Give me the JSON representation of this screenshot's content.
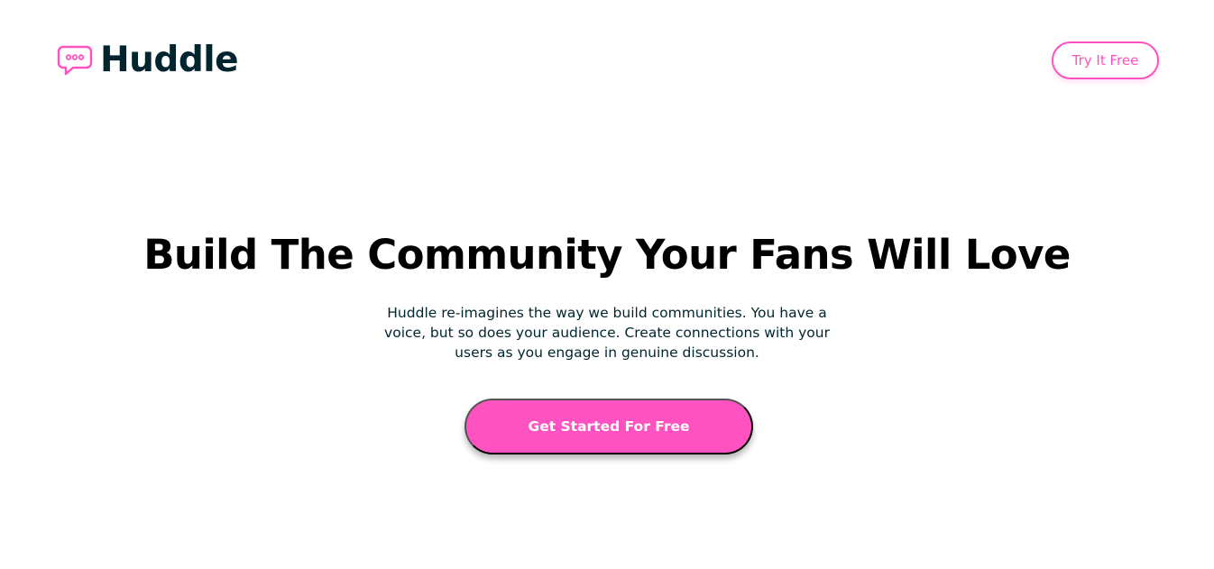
{
  "header": {
    "logo_text": "Huddle",
    "logo_icon": "chat-bubble-icon",
    "try_button_label": "Try It Free"
  },
  "hero": {
    "title": "Build The Community Your Fans Will Love",
    "description": "Huddle re-imagines the way we build communities. You have a voice, but so does your audience. Create connections with your users as you engage in genuine discussion.",
    "cta_label": "Get Started For Free"
  },
  "colors": {
    "accent": "#ff52c1",
    "dark": "#00252e",
    "background": "#ffffff"
  }
}
